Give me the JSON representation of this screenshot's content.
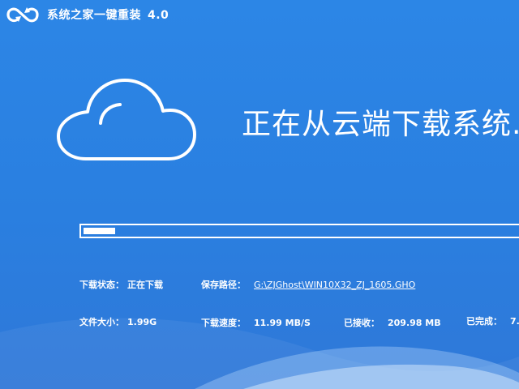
{
  "app": {
    "title": "系统之家一键重装",
    "version": "4.0"
  },
  "heading": "正在从云端下载系统...",
  "progress": {
    "fraction": 0.07
  },
  "status": {
    "download_state_label": "下载状态：",
    "download_state_value": "正在下载",
    "save_path_label": "保存路径：",
    "save_path_value": "G:\\ZJGhost\\WIN10X32_ZJ_1605.GHO",
    "file_size_label": "文件大小：",
    "file_size_value": "1.99G",
    "speed_label": "下载速度：",
    "speed_value": "11.99 MB/S",
    "received_label": "已接收：",
    "received_value": "209.98 MB",
    "completed_label": "已完成：",
    "completed_value": "7."
  },
  "colors": {
    "background": "#2c86e6",
    "foreground": "#ffffff"
  },
  "icons": {
    "logo": "loop-arrows-logo-icon",
    "cloud": "cloud-icon"
  }
}
